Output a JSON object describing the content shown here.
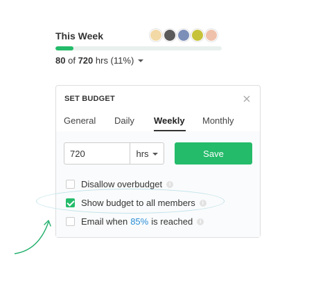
{
  "week": {
    "title": "This Week",
    "avatars": [
      {
        "name": "avatar-1",
        "color": "#f3d9a6"
      },
      {
        "name": "avatar-2",
        "color": "#5a5a5a"
      },
      {
        "name": "avatar-3",
        "color": "#7c8fb8"
      },
      {
        "name": "avatar-4",
        "color": "#c6c23a"
      },
      {
        "name": "avatar-5",
        "color": "#efc1ab"
      }
    ],
    "progress_percent": 11,
    "hours_used": "80",
    "hours_of": "of",
    "hours_total": "720",
    "hours_suffix": "hrs (11%)"
  },
  "budget_panel": {
    "header": "SET BUDGET",
    "tabs": [
      {
        "label": "General",
        "active": false
      },
      {
        "label": "Daily",
        "active": false
      },
      {
        "label": "Weekly",
        "active": true
      },
      {
        "label": "Monthly",
        "active": false
      }
    ],
    "amount_value": "720",
    "unit_label": "hrs",
    "save_label": "Save",
    "options": [
      {
        "label": "Disallow overbudget",
        "checked": false
      },
      {
        "label": "Show budget to all members",
        "checked": true
      },
      {
        "label_before": "Email when",
        "percent": "85%",
        "label_after": "is reached",
        "checked": false
      }
    ]
  },
  "colors": {
    "accent_green": "#24bb6a",
    "link_blue": "#2a8fd6",
    "annotation_ellipse": "#bfe3ea",
    "annotation_arrow": "#1fae6a"
  },
  "icons": {
    "close": "close-icon",
    "info": "info-icon",
    "dropdown": "chevron-down-icon",
    "check": "check-icon"
  }
}
